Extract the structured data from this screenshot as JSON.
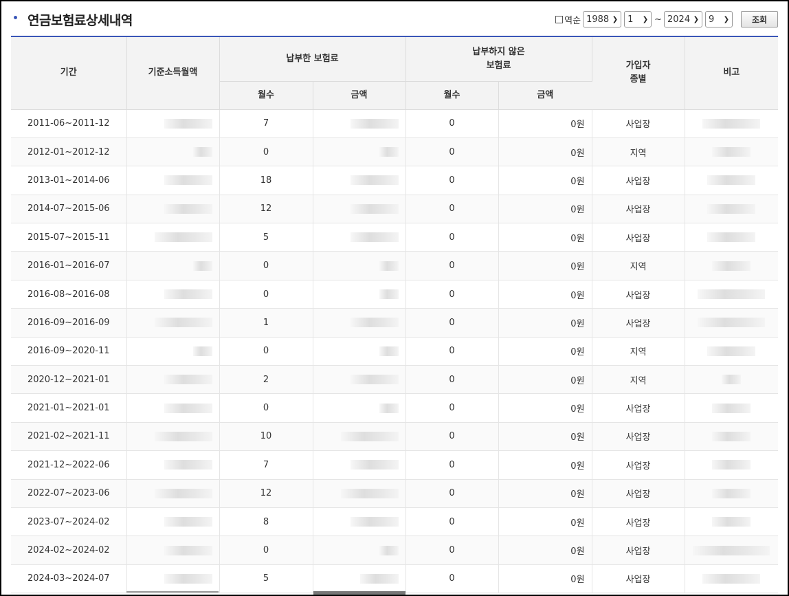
{
  "header": {
    "title": "연금보험료상세내역",
    "reverse_label": "역순",
    "from_year": "1988",
    "from_month": "1",
    "tilde": "~",
    "to_year": "2024",
    "to_month": "9",
    "query_button": "조회"
  },
  "table": {
    "headers": {
      "period": "기간",
      "base_income": "기준소득월액",
      "paid": "납부한 보험료",
      "unpaid_line1": "납부하지 않은",
      "unpaid_line2": "보험료",
      "subscriber_line1": "가입자",
      "subscriber_line2": "종별",
      "note": "비고",
      "months": "월수",
      "amount": "금액"
    },
    "rows": [
      {
        "period": "2011-06~2011-12",
        "paid_months": "7",
        "unpaid_months": "0",
        "unpaid_amount": "0원",
        "type": "사업장"
      },
      {
        "period": "2012-01~2012-12",
        "paid_months": "0",
        "unpaid_months": "0",
        "unpaid_amount": "0원",
        "type": "지역"
      },
      {
        "period": "2013-01~2014-06",
        "paid_months": "18",
        "unpaid_months": "0",
        "unpaid_amount": "0원",
        "type": "사업장"
      },
      {
        "period": "2014-07~2015-06",
        "paid_months": "12",
        "unpaid_months": "0",
        "unpaid_amount": "0원",
        "type": "사업장"
      },
      {
        "period": "2015-07~2015-11",
        "paid_months": "5",
        "unpaid_months": "0",
        "unpaid_amount": "0원",
        "type": "사업장"
      },
      {
        "period": "2016-01~2016-07",
        "paid_months": "0",
        "unpaid_months": "0",
        "unpaid_amount": "0원",
        "type": "지역"
      },
      {
        "period": "2016-08~2016-08",
        "paid_months": "0",
        "unpaid_months": "0",
        "unpaid_amount": "0원",
        "type": "사업장"
      },
      {
        "period": "2016-09~2016-09",
        "paid_months": "1",
        "unpaid_months": "0",
        "unpaid_amount": "0원",
        "type": "사업장"
      },
      {
        "period": "2016-09~2020-11",
        "paid_months": "0",
        "unpaid_months": "0",
        "unpaid_amount": "0원",
        "type": "지역"
      },
      {
        "period": "2020-12~2021-01",
        "paid_months": "2",
        "unpaid_months": "0",
        "unpaid_amount": "0원",
        "type": "지역"
      },
      {
        "period": "2021-01~2021-01",
        "paid_months": "0",
        "unpaid_months": "0",
        "unpaid_amount": "0원",
        "type": "사업장"
      },
      {
        "period": "2021-02~2021-11",
        "paid_months": "10",
        "unpaid_months": "0",
        "unpaid_amount": "0원",
        "type": "사업장"
      },
      {
        "period": "2021-12~2022-06",
        "paid_months": "7",
        "unpaid_months": "0",
        "unpaid_amount": "0원",
        "type": "사업장"
      },
      {
        "period": "2022-07~2023-06",
        "paid_months": "12",
        "unpaid_months": "0",
        "unpaid_amount": "0원",
        "type": "사업장"
      },
      {
        "period": "2023-07~2024-02",
        "paid_months": "8",
        "unpaid_months": "0",
        "unpaid_amount": "0원",
        "type": "사업장"
      },
      {
        "period": "2024-02~2024-02",
        "paid_months": "0",
        "unpaid_months": "0",
        "unpaid_amount": "0원",
        "type": "사업장"
      },
      {
        "period": "2024-03~2024-07",
        "paid_months": "5",
        "unpaid_months": "0",
        "unpaid_amount": "0원",
        "type": "사업장"
      }
    ]
  }
}
